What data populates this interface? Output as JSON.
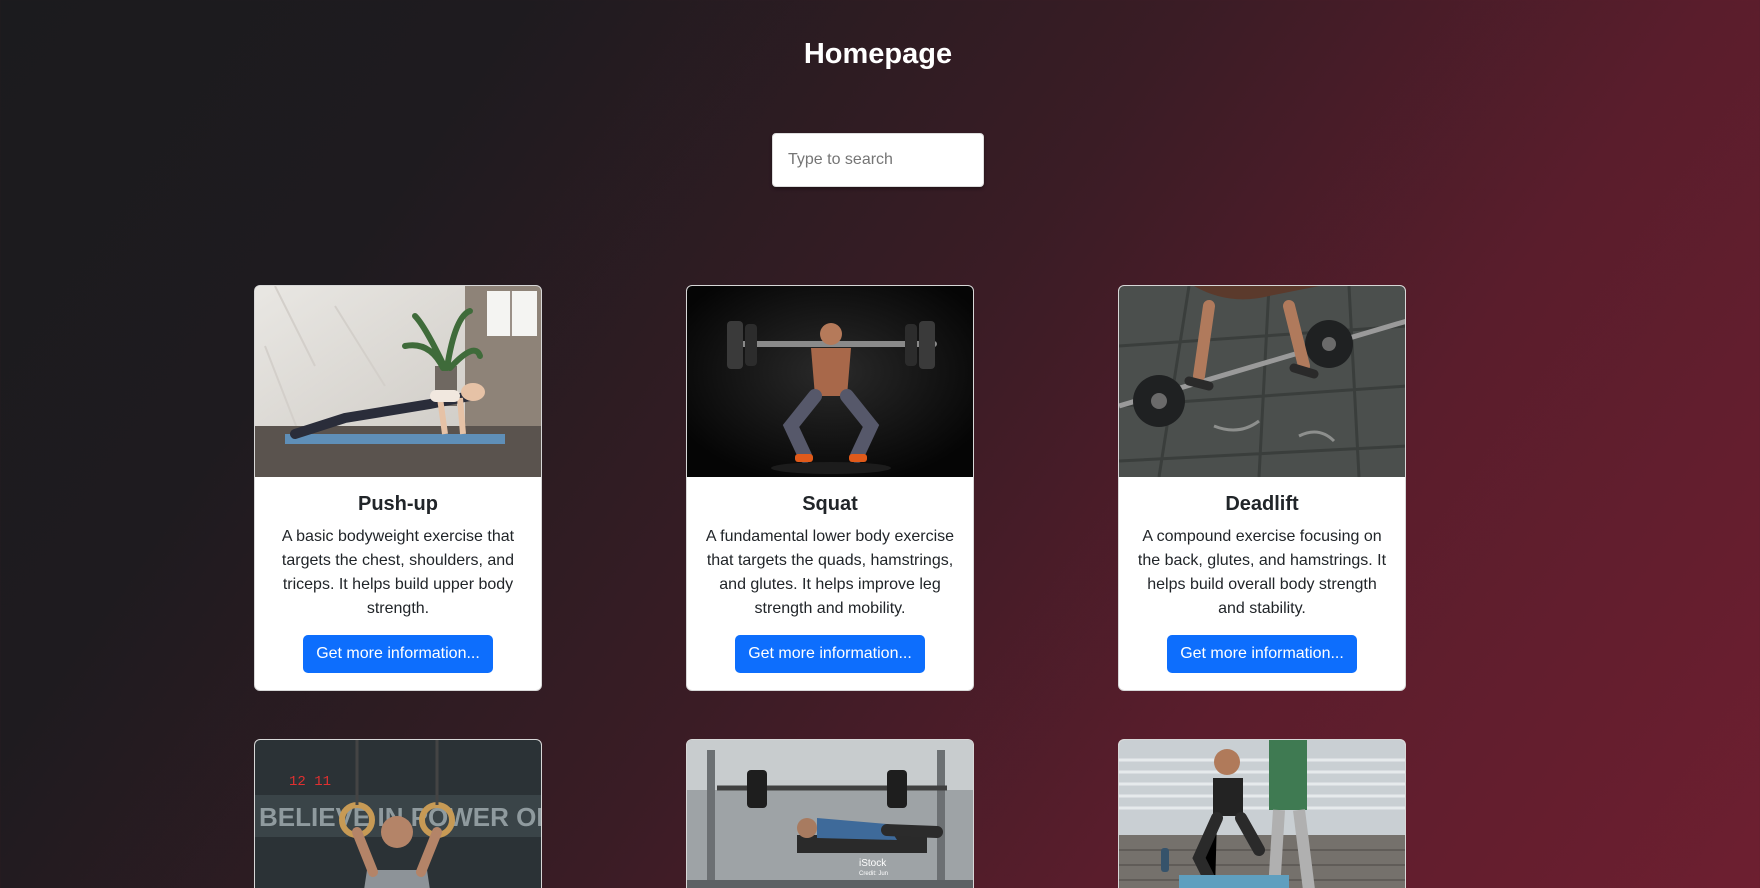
{
  "header": {
    "title": "Homepage"
  },
  "search": {
    "placeholder": "Type to search"
  },
  "exercises": [
    {
      "title": "Push-up",
      "description": "A basic bodyweight exercise that targets the chest, shoulders, and triceps. It helps build upper body strength.",
      "button_label": "Get more information..."
    },
    {
      "title": "Squat",
      "description": "A fundamental lower body exercise that targets the quads, hamstrings, and glutes. It helps improve leg strength and mobility.",
      "button_label": "Get more information..."
    },
    {
      "title": "Deadlift",
      "description": "A compound exercise focusing on the back, glutes, and hamstrings. It helps build overall body strength and stability.",
      "button_label": "Get more information..."
    }
  ],
  "partial_cards": [
    {
      "image": "ring-exercise-photo",
      "overlay_text": "BELIEVE IN POWER OF COMMU",
      "clock_text": "12 11"
    },
    {
      "image": "bench-press-photo",
      "watermark": "iStock",
      "watermark_sub": "Credit: Jun"
    },
    {
      "image": "lunge-training-photo"
    }
  ],
  "colors": {
    "button": "#0d6efd",
    "card_background": "#ffffff",
    "background_start": "#1b1b1e",
    "background_end": "#6d1f30"
  }
}
